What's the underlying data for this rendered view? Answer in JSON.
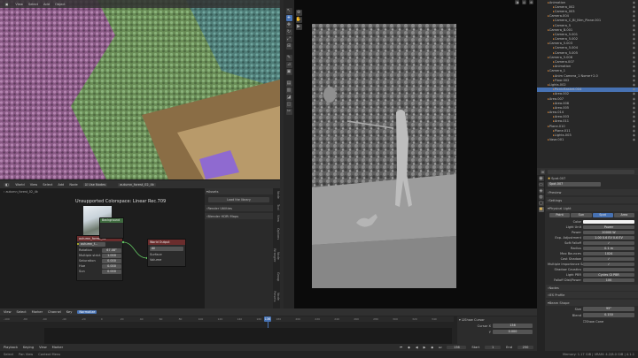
{
  "viewport3d": {
    "menu": [
      "View",
      "Select",
      "Add",
      "Object"
    ],
    "mode": "Object Mode",
    "status_text": "..."
  },
  "node_editor": {
    "menu": [
      "World",
      "View",
      "Select",
      "Add",
      "Node"
    ],
    "use_nodes": "Use Nodes",
    "world_name": "autumn_forest_02_4k",
    "colorspace_label": "Unsupported Colorspace: Linear Rec.709",
    "tex_node": {
      "title": "autumn_forest_02",
      "image": "autumn_f...",
      "fields": [
        {
          "label": "Rotation",
          "value": "67.08°"
        },
        {
          "label": "Multiple strict",
          "value": "1.000"
        },
        {
          "label": "Saturation",
          "value": "0.000"
        },
        {
          "label": "Hue",
          "value": "0.000"
        },
        {
          "label": "Sun",
          "value": "0.000"
        }
      ]
    },
    "bg_node": {
      "title": "Background"
    },
    "output_node": {
      "title": "World Output",
      "target": "All",
      "sockets": [
        "Surface",
        "Volume"
      ]
    },
    "sidebar": {
      "title": "Assets",
      "load_button": "Load the library",
      "items": [
        "Render Utilities",
        "Blender HDRI Maps"
      ]
    },
    "side_tabs": [
      "Node",
      "Tool",
      "View",
      "Options",
      "Node Wrangler",
      "Group",
      "Node Presets"
    ]
  },
  "outliner": {
    "items": [
      "Animation",
      "Camera_002",
      "Camera_003",
      "Camera.004",
      "Camera_C_Bl_Nim_Plane.001",
      "Camera_5",
      "Camera_B.001",
      "Camera_5.001",
      "Camera_5.002",
      "Camera_5.003",
      "Camera_5.004",
      "Camera_5.005",
      "Camera_5.006",
      "Camera.007",
      "Animation",
      "Camera_1",
      "Anim Camera_1 Nome+2.0",
      "Floor.002",
      "Lights.002",
      "PicnicBasket.004",
      "Area.002",
      "Area.007",
      "Area.008",
      "Area.005",
      "Area.014",
      "Area.003",
      "Area.011",
      "Plane.010",
      "Plane.011",
      "Lights.003",
      "Vase.001"
    ],
    "selected_index": 19
  },
  "properties": {
    "object_name": "Spot.007",
    "data_name": "Spot.007",
    "sections": [
      "Preview",
      "Settings",
      "Physical Light"
    ],
    "light_types": [
      "Point",
      "Sun",
      "Spot",
      "Area"
    ],
    "rows": [
      {
        "label": "Color",
        "value": ""
      },
      {
        "label": "Light Unit",
        "value": "Power"
      },
      {
        "label": "Power",
        "value": "20000 W"
      },
      {
        "label": "Exp. Adjustment",
        "value": "1.00 0.6 EV 0.6 EV"
      },
      {
        "label": "Soft Falloff",
        "value": "✓"
      },
      {
        "label": "Radius",
        "value": "0.1 m"
      },
      {
        "label": "Max Bounces",
        "value": "1024"
      },
      {
        "label": "Cast Shadow",
        "value": "✓"
      },
      {
        "label": "Multiple Importance Sample",
        "value": "✓"
      },
      {
        "label": "Shadow Caustics",
        "value": ""
      },
      {
        "label": "Light PBR",
        "value": "Cycles GI PBR"
      },
      {
        "label": "Falloff Dist/Power",
        "value": "100"
      }
    ],
    "extra": [
      "Nodes",
      "IES Profile"
    ],
    "beam_shape": {
      "title": "Beam Shape",
      "size_label": "Size",
      "size_value": "95°",
      "blend_label": "Blend",
      "blend_value": "0.150",
      "show_cone": "Show Cone"
    }
  },
  "timeline": {
    "menu": [
      "View",
      "Select",
      "Marker",
      "Channel",
      "Key"
    ],
    "mode": "Normalize",
    "ticks": [
      "-100",
      "-80",
      "-60",
      "-40",
      "-20",
      "0",
      "20",
      "40",
      "60",
      "80",
      "100",
      "120",
      "140",
      "160",
      "180",
      "200",
      "220",
      "240",
      "260",
      "280",
      "300",
      "320",
      "340"
    ],
    "current_frame": "136",
    "show_cursor": "Show Cursor",
    "cursor_x_label": "Cursor X",
    "cursor_x": "136",
    "cursor_y_label": "Y",
    "cursor_y": "0.000",
    "playback": "Playback",
    "keying": "Keying",
    "view": "View",
    "marker": "Marker",
    "frame": "136",
    "start_label": "Start",
    "start": "1",
    "end_label": "End",
    "end": "250"
  },
  "status": {
    "left": [
      "Select",
      "Pan View",
      "Context Menu"
    ],
    "right": "Memory: 1.17 GiB | VRAM: 4.2/8.0 GiB | 4.1.1"
  }
}
